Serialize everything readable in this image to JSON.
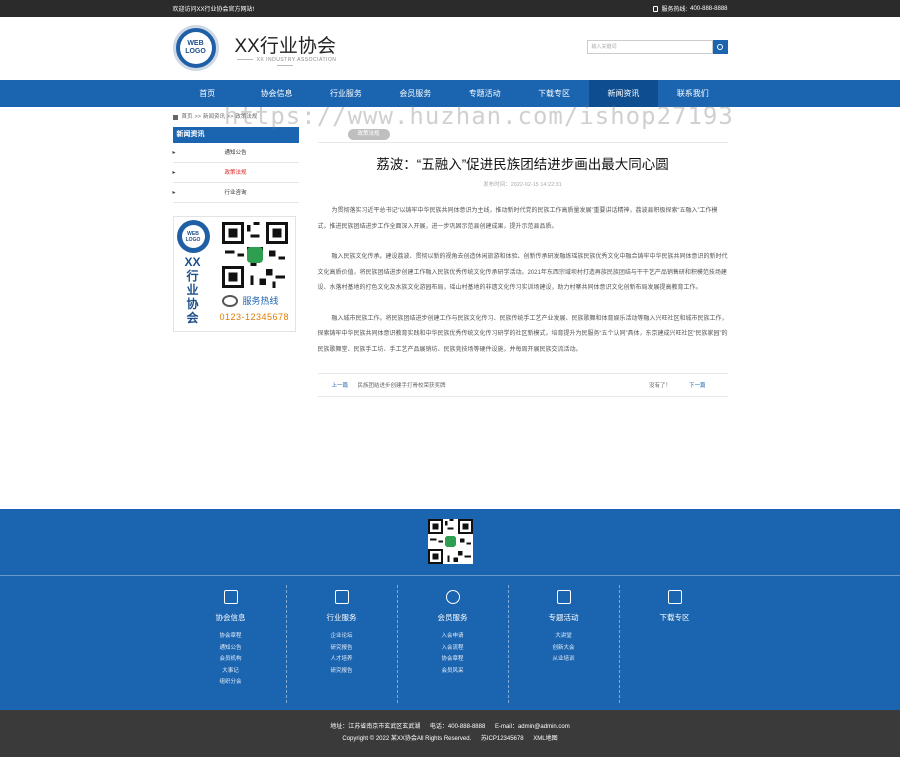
{
  "topbar": {
    "welcome": "欢迎访问XX行业协会官方网站!",
    "hotline_label": "服务热线:",
    "hotline": "400-888-8888"
  },
  "header": {
    "logo_line1": "WEB",
    "logo_line2": "LOGO",
    "title": "XX行业协会",
    "subtitle": "XX INDUSTRY ASSOCIATION",
    "search_placeholder": "输入关键词"
  },
  "nav": [
    {
      "label": "首页"
    },
    {
      "label": "协会信息"
    },
    {
      "label": "行业服务"
    },
    {
      "label": "会员服务"
    },
    {
      "label": "专题活动"
    },
    {
      "label": "下载专区"
    },
    {
      "label": "新闻资讯"
    },
    {
      "label": "联系我们"
    }
  ],
  "breadcrumb": {
    "home": "首页",
    "sep": ">>",
    "level1": "新闻资讯",
    "level2": "政策法规"
  },
  "watermark": "https://www.huzhan.com/ishop27193",
  "sidebar": {
    "heading": "新闻资讯",
    "items": [
      {
        "label": "通知公告"
      },
      {
        "label": "政策法规"
      },
      {
        "label": "行业咨询"
      }
    ],
    "card": {
      "logo1": "WEB",
      "logo2": "LOGO",
      "vertical": "XX行业协会",
      "hotline_label": "服务热线",
      "hotline": "0123-12345678"
    }
  },
  "article": {
    "tag": "政策法规",
    "title": "荔波：“五融入”促进民族团结进步画出最大同心圆",
    "meta": "发布时间：2022-02-15 14:22:31",
    "paragraphs": [
      "为贯彻落实习近平总书记“以铸牢中华民族共同体意识为主线，推动新时代党的民族工作高质量发展”重要讲话精神，荔波县积极探索“五融入”工作模式，推进民族团结进步工作全面深入开展，进一步巩固示范县创建成果，提升示范县品质。",
      "融入民族文化传承。建设荔波、贯彻以新的视角去创造休闲旅游和体验、创新传承研发融练瑶族民族优秀文化中融合铸牢中华民族共同体意识的新时代文化高质价值，将民族团结进步创建工作融入民族优秀传统文化传承研学活动。2021年东西宗域坝村打造再族民族团结与干干艺产品销售研和积模范技场建设、水落村基地的打色文化及水族文化游园布局，瑶山村基地的非遗文化传习实训场建设，助力村寨共同体意识文化创新布局发展提高教育工作。",
      "融入城市民族工作。将民族团结进步创建工作与民族文化传习、民族传统手工艺产业发展、民族歌舞和体育娱乐活动等融入兴旺社区和城市民族工作，探索铸牢中华民族共同体意识教育实践和中华民族优秀传统文化传习研学的社区新模式，培育提升为民服务“五个认同”具体，东京建成兴旺社区“民族家园”的民族歌舞堂、民族手工坊、手工艺产品展销坊、民族竞技场等硬件设施，并每周开展民族交流活动。"
    ],
    "prev_label": "上一篇",
    "prev_title": "民族团结进步创建手打骨校荣获奖牌",
    "next_none": "没有了！",
    "next_label": "下一篇"
  },
  "footer": {
    "columns": [
      {
        "heading": "协会信息",
        "icon": "calendar-icon",
        "links": [
          "协会章程",
          "通知公告",
          "会员机构",
          "大事记",
          "组织分会"
        ]
      },
      {
        "heading": "行业服务",
        "icon": "box-icon",
        "links": [
          "企业论坛",
          "研究报告",
          "人才培养",
          "研究报告"
        ]
      },
      {
        "heading": "会员服务",
        "icon": "users-icon",
        "links": [
          "入会申请",
          "入会流程",
          "协会章程",
          "会员风采"
        ]
      },
      {
        "heading": "专题活动",
        "icon": "printer-icon",
        "links": [
          "大讲堂",
          "创新大会",
          "从业培训"
        ]
      },
      {
        "heading": "下载专区",
        "icon": "download-icon",
        "links": []
      }
    ]
  },
  "bottom": {
    "address": "地址：江苏省南京市玄武区玄武湖",
    "tel": "电话：400-888-8888",
    "email": "E-mail：admin@admin.com",
    "copyright": "Copyright © 2022 某XX协会All Rights Reserved.",
    "icp": "苏ICP12345678",
    "sitemap": "XML地图"
  }
}
